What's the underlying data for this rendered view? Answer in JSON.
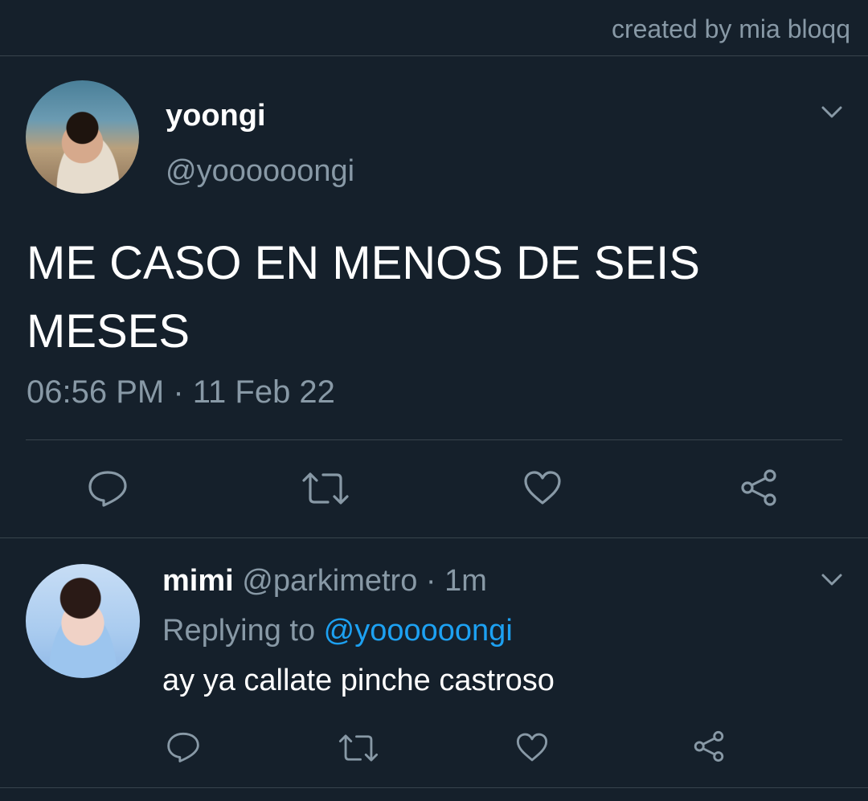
{
  "credit": "created by mia bloqq",
  "tweet": {
    "display_name": "yoongi",
    "handle": "@yoooooongi",
    "text": "ME CASO EN MENOS DE SEIS MESES",
    "timestamp": "06:56 PM · 11 Feb 22",
    "actions": [
      "reply-icon",
      "retweet-icon",
      "like-icon",
      "share-icon"
    ]
  },
  "reply": {
    "display_name": "mimi",
    "handle": "@parkimetro",
    "separator": " · ",
    "time": "1m",
    "replying_prefix": "Replying to ",
    "replying_to": "@yoooooongi",
    "text": "ay ya callate pinche castroso"
  },
  "colors": {
    "background": "#15202b",
    "secondary_text": "#8899a6",
    "link": "#1da1f2",
    "divider": "#38444d"
  }
}
